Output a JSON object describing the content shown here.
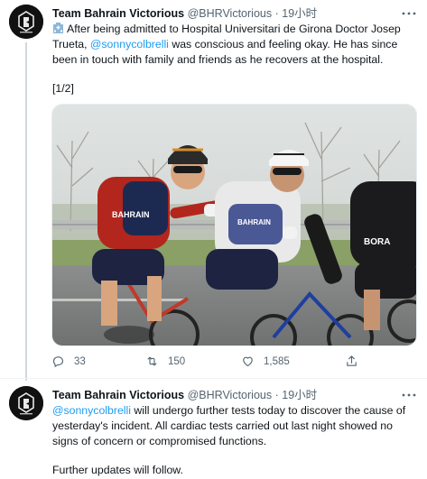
{
  "tweets": [
    {
      "display_name": "Team Bahrain Victorious",
      "handle": "@BHRVictorious",
      "separator": "·",
      "time": "19小时",
      "line1_rest": "After being admitted to Hospital Universitari de Girona Doctor Josep Trueta, ",
      "mention": "@sonnycolbrelli",
      "line_after_mention": " was conscious and feeling okay. He has since been in touch with family and friends as he recovers at the hospital.",
      "thread_marker": "[1/2]",
      "stats": {
        "replies": "33",
        "retweets": "150",
        "likes": "1,585"
      }
    },
    {
      "display_name": "Team Bahrain Victorious",
      "handle": "@BHRVictorious",
      "separator": "·",
      "time": "19小时",
      "mention": "@sonnycolbrelli",
      "line_after_mention": " will undergo further tests today to discover the cause of yesterday's incident. All cardiac tests carried out last night showed no signs of concern or compromised functions.",
      "last_paragraph": "Further updates will follow."
    }
  ],
  "photo": {
    "jersey_texts": [
      "BAHRAIN",
      "BAHRAIN",
      "BORA"
    ]
  },
  "icons": {
    "more": "more-icon",
    "reply": "reply-icon",
    "retweet": "retweet-icon",
    "like": "like-icon",
    "share": "share-icon"
  },
  "colors": {
    "link": "#1d9bf0",
    "secondary_text": "#536471",
    "text": "#0f1419"
  }
}
